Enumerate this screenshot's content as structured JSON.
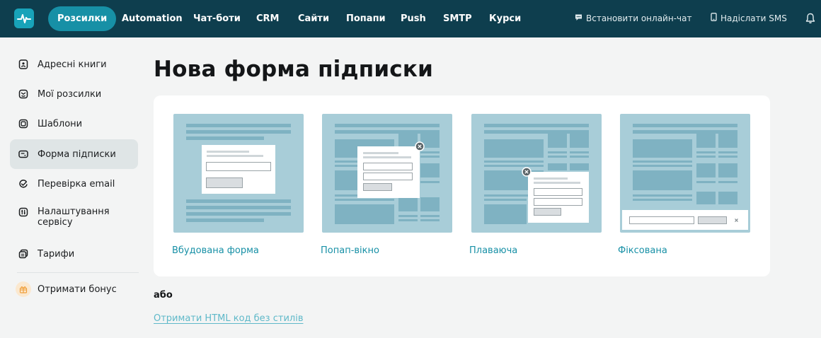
{
  "colors": {
    "topbar": "#0e3e4e",
    "accent": "#1790a6",
    "link": "#1790a6",
    "thumb_bg": "#a8cdd8",
    "active_side": "#dfe5e6"
  },
  "header": {
    "logo_icon": "pulse-logo-icon",
    "nav": [
      {
        "label": "Розсилки",
        "active": true
      },
      {
        "label": "Automation"
      },
      {
        "label": "Чат-боти"
      },
      {
        "label": "CRM"
      },
      {
        "label": "Сайти"
      },
      {
        "label": "Попапи"
      },
      {
        "label": "Push"
      },
      {
        "label": "SMTP"
      },
      {
        "label": "Курси"
      }
    ],
    "install_chat": {
      "label": "Встановити онлайн-чат",
      "icon": "chat-icon"
    },
    "send_sms": {
      "label": "Надіслати SMS",
      "icon": "phone-icon"
    },
    "notifications_icon": "bell-icon"
  },
  "sidebar": {
    "items": [
      {
        "label": "Адресні книги",
        "icon": "address-book-icon"
      },
      {
        "label": "Мої розсилки",
        "icon": "mail-smile-icon"
      },
      {
        "label": "Шаблони",
        "icon": "templates-icon"
      },
      {
        "label": "Форма підписки",
        "icon": "form-icon",
        "active": true
      },
      {
        "label": "Перевірка email",
        "icon": "check-email-icon"
      },
      {
        "label": "Налаштування сервісу",
        "icon": "settings-icon"
      },
      {
        "label": "Тарифи",
        "icon": "pricing-icon"
      }
    ],
    "bonus": {
      "label": "Отримати бонус",
      "icon": "gift-icon"
    }
  },
  "main": {
    "title": "Нова форма підписки",
    "options": [
      {
        "label": "Вбудована форма"
      },
      {
        "label": "Попап-вікно"
      },
      {
        "label": "Плаваюча"
      },
      {
        "label": "Фіксована"
      }
    ],
    "or_text": "або",
    "raw_html_link": "Отримати HTML код без стилів"
  }
}
